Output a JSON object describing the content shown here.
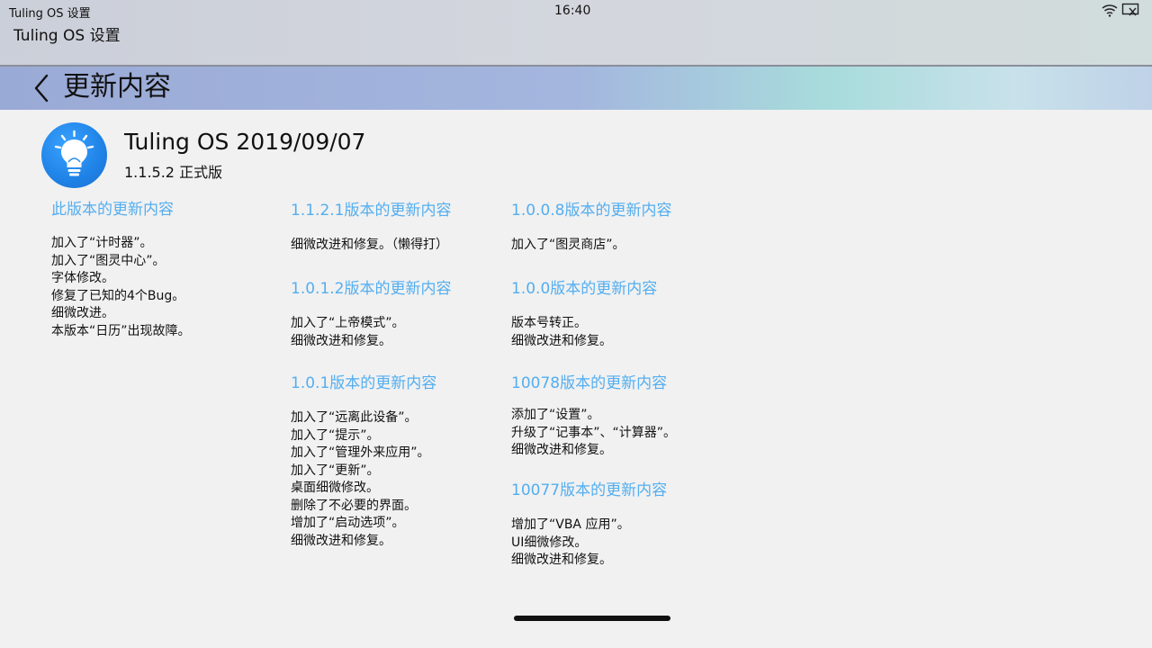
{
  "window": {
    "title_small": "Tuling OS 设置",
    "title": "Tuling OS 设置",
    "clock": "16:40"
  },
  "status_icons": [
    "wifi-icon",
    "cast-icon"
  ],
  "header": {
    "title": "更新内容",
    "back_icon": "chevron-left-icon"
  },
  "app": {
    "icon": "lightbulb-icon",
    "name": "Tuling OS 2019/09/07",
    "version": "1.1.5.2 正式版"
  },
  "sections": {
    "current": {
      "title": "此版本的更新内容",
      "items": [
        "加入了“计时器”。",
        "加入了“图灵中心”。",
        "字体修改。",
        "修复了已知的4个Bug。",
        "细微改进。",
        "本版本“日历”出现故障。"
      ]
    },
    "v1121": {
      "title": "1.1.2.1版本的更新内容",
      "items": [
        "细微改进和修复。（懒得打）"
      ]
    },
    "v1012": {
      "title": "1.0.1.2版本的更新内容",
      "items": [
        "加入了“上帝模式”。",
        "细微改进和修复。"
      ]
    },
    "v101": {
      "title": "1.0.1版本的更新内容",
      "items": [
        "加入了“远离此设备”。",
        "加入了“提示”。",
        "加入了“管理外来应用”。",
        "加入了“更新”。",
        "桌面细微修改。",
        "删除了不必要的界面。",
        "增加了“启动选项”。",
        "细微改进和修复。"
      ]
    },
    "v1008": {
      "title": "1.0.0.8版本的更新内容",
      "items": [
        "加入了“图灵商店”。"
      ]
    },
    "v100": {
      "title": "1.0.0版本的更新内容",
      "items": [
        "版本号转正。",
        "细微改进和修复。"
      ]
    },
    "v10078": {
      "title": "10078版本的更新内容",
      "items": [
        "添加了“设置”。",
        "升级了“记事本”、“计算器”。",
        "细微改进和修复。"
      ]
    },
    "v10077": {
      "title": "10077版本的更新内容",
      "items": [
        "增加了“VBA 应用”。",
        "UI细微修改。",
        "细微改进和修复。"
      ]
    }
  },
  "colors": {
    "section_title": "#53aef0",
    "icon_blue": "#1f82e6"
  }
}
